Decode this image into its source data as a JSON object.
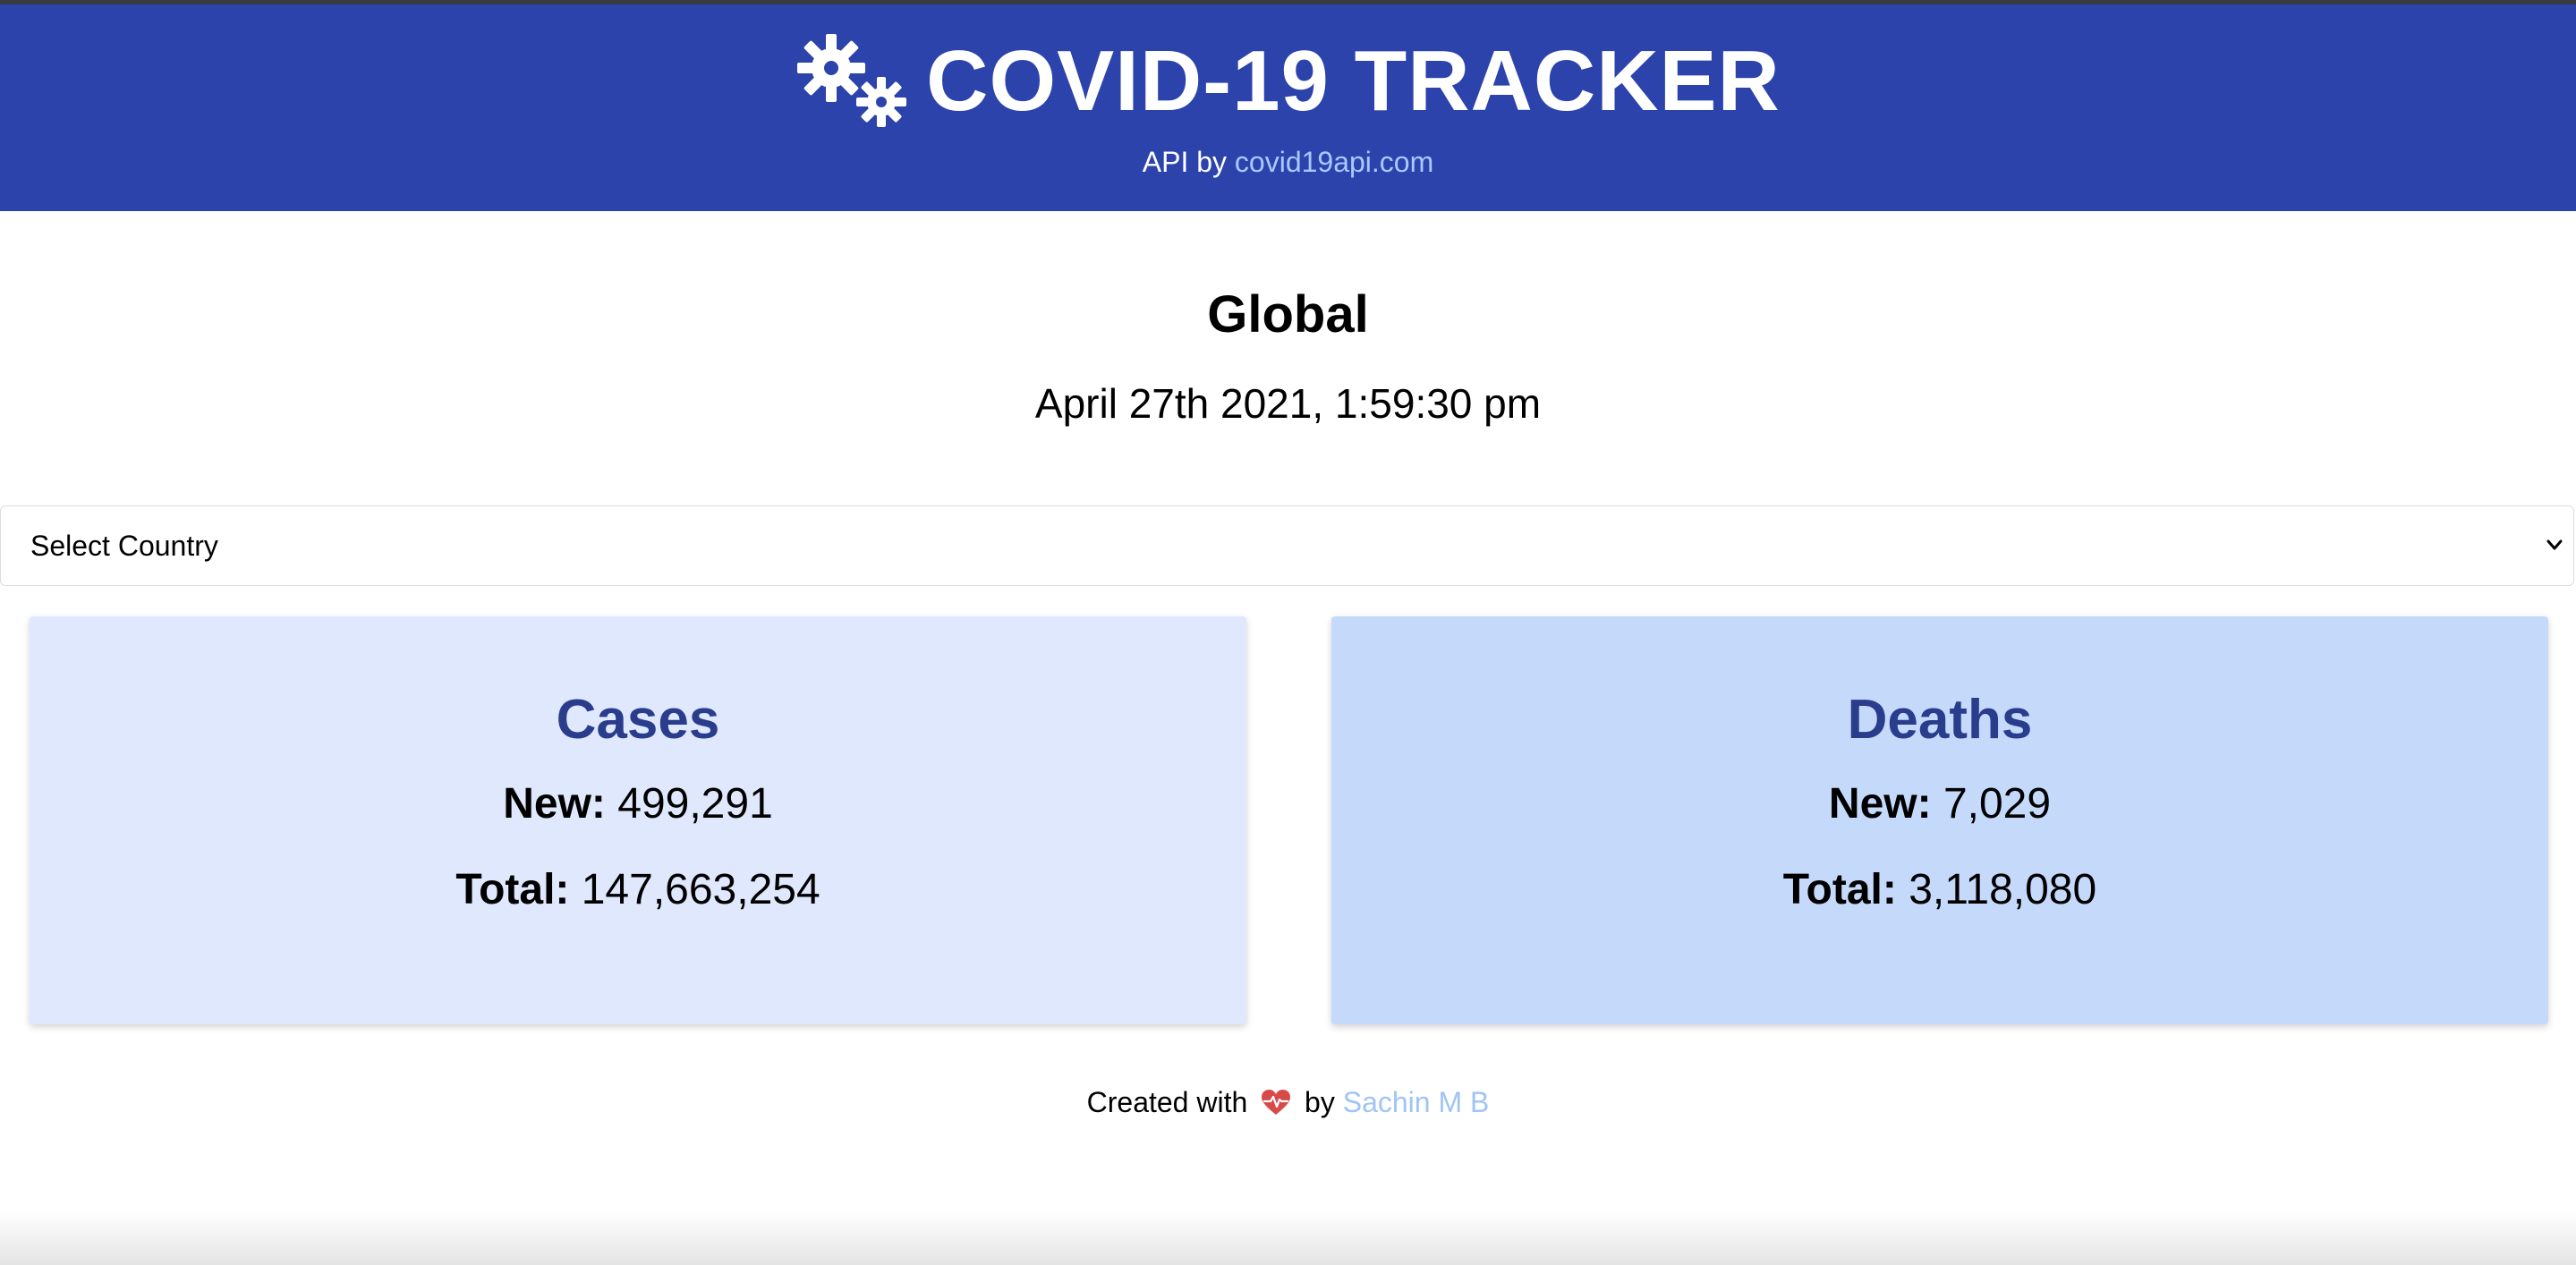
{
  "header": {
    "title": "COVID-19 TRACKER",
    "api_prefix": "API by",
    "api_link_text": "covid19api.com",
    "logo_icon": "gears-icon"
  },
  "summary": {
    "region": "Global",
    "datetime": "April 27th 2021, 1:59:30 pm"
  },
  "country_select": {
    "selected": "Select Country",
    "icon": "chevron-down-icon"
  },
  "cards": {
    "cases": {
      "title": "Cases",
      "new_label": "New:",
      "new_value": "499,291",
      "total_label": "Total:",
      "total_value": "147,663,254",
      "background": "#dfe8fc"
    },
    "deaths": {
      "title": "Deaths",
      "new_label": "New:",
      "new_value": "7,029",
      "total_label": "Total:",
      "total_value": "3,118,080",
      "background": "#c5d9fb"
    }
  },
  "footer": {
    "prefix": "Created with",
    "icon": "heart-icon",
    "by": "by",
    "author": "Sachin M B"
  },
  "colors": {
    "header_bg": "#2c43ac",
    "card_title": "#2a3c8c",
    "link": "#a9c8ff",
    "heart": "#d84a4a"
  }
}
